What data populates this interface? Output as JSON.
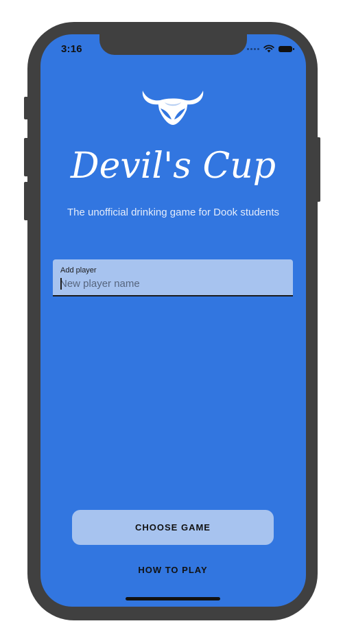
{
  "status_bar": {
    "time": "3:16",
    "icons": [
      "signal-dots-icon",
      "wifi-icon",
      "battery-icon"
    ]
  },
  "app": {
    "logo_icon": "devil-horns-logo",
    "title": "Devil's Cup",
    "subtitle": "The unofficial drinking game for Dook students"
  },
  "add_player": {
    "label": "Add player",
    "value": "",
    "placeholder": "New player name"
  },
  "actions": {
    "choose_game_label": "CHOOSE GAME",
    "how_to_play_label": "HOW TO PLAY"
  },
  "colors": {
    "background": "#3276e0",
    "button": "#a7c3ef",
    "phone_frame": "#404040",
    "text_light": "#ffffff"
  }
}
